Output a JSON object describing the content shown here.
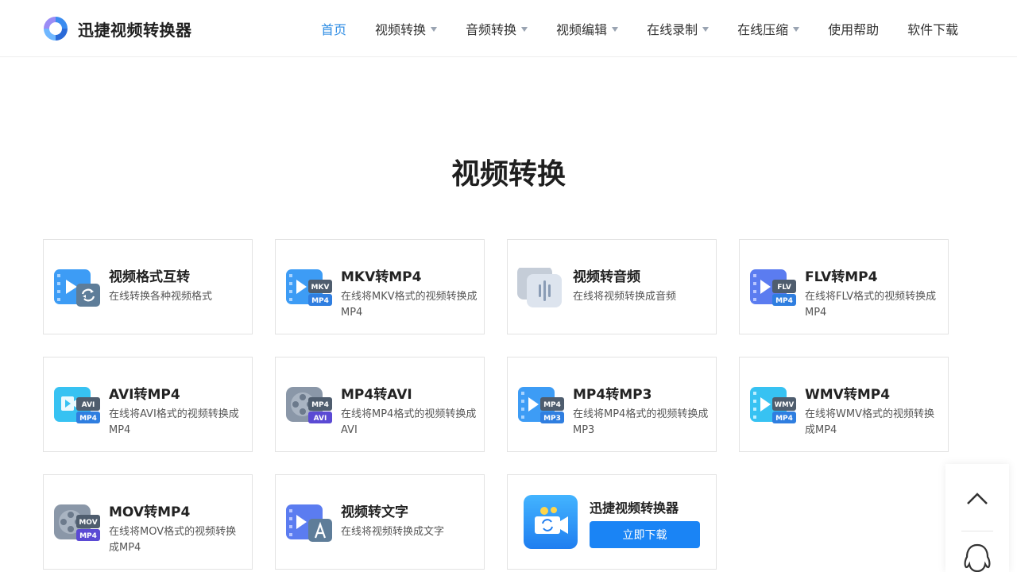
{
  "brand": {
    "name": "迅捷视频转换器"
  },
  "nav": {
    "items": [
      {
        "label": "首页",
        "active": true,
        "dropdown": false
      },
      {
        "label": "视频转换",
        "active": false,
        "dropdown": true
      },
      {
        "label": "音频转换",
        "active": false,
        "dropdown": true
      },
      {
        "label": "视频编辑",
        "active": false,
        "dropdown": true
      },
      {
        "label": "在线录制",
        "active": false,
        "dropdown": true
      },
      {
        "label": "在线压缩",
        "active": false,
        "dropdown": true
      },
      {
        "label": "使用帮助",
        "active": false,
        "dropdown": false
      },
      {
        "label": "软件下载",
        "active": false,
        "dropdown": false
      }
    ]
  },
  "section": {
    "title": "视频转换"
  },
  "cards": [
    {
      "title": "视频格式互转",
      "desc": "在线转换各种视频格式",
      "icon": "video-format-convert-icon",
      "badge_top": "",
      "badge_bottom": ""
    },
    {
      "title": "MKV转MP4",
      "desc": "在线将MKV格式的视频转换成MP4",
      "icon": "mkv-to-mp4-icon",
      "badge_top": "MKV",
      "badge_bottom": "MP4"
    },
    {
      "title": "视频转音频",
      "desc": "在线将视频转换成音频",
      "icon": "video-to-audio-icon",
      "badge_top": "",
      "badge_bottom": ""
    },
    {
      "title": "FLV转MP4",
      "desc": "在线将FLV格式的视频转换成MP4",
      "icon": "flv-to-mp4-icon",
      "badge_top": "FLV",
      "badge_bottom": "MP4"
    },
    {
      "title": "AVI转MP4",
      "desc": "在线将AVI格式的视频转换成MP4",
      "icon": "avi-to-mp4-icon",
      "badge_top": "AVI",
      "badge_bottom": "MP4"
    },
    {
      "title": "MP4转AVI",
      "desc": "在线将MP4格式的视频转换成AVI",
      "icon": "mp4-to-avi-icon",
      "badge_top": "MP4",
      "badge_bottom": "AVI"
    },
    {
      "title": "MP4转MP3",
      "desc": "在线将MP4格式的视频转换成MP3",
      "icon": "mp4-to-mp3-icon",
      "badge_top": "MP4",
      "badge_bottom": "MP3"
    },
    {
      "title": "WMV转MP4",
      "desc": "在线将WMV格式的视频转换成MP4",
      "icon": "wmv-to-mp4-icon",
      "badge_top": "WMV",
      "badge_bottom": "MP4"
    },
    {
      "title": "MOV转MP4",
      "desc": "在线将MOV格式的视频转换成MP4",
      "icon": "mov-to-mp4-icon",
      "badge_top": "MOV",
      "badge_bottom": "MP4"
    },
    {
      "title": "视频转文字",
      "desc": "在线将视频转换成文字",
      "icon": "video-to-text-icon",
      "badge_top": "",
      "badge_bottom": ""
    }
  ],
  "promo": {
    "title": "迅捷视频转换器",
    "button_label": "立即下载",
    "icon": "app-icon"
  },
  "float_panel": {
    "top_icon": "chevron-up-icon",
    "qq_icon": "qq-penguin-icon"
  },
  "colors": {
    "accent": "#2f8de4",
    "button": "#1a84f5",
    "border": "#e3e3e3"
  }
}
